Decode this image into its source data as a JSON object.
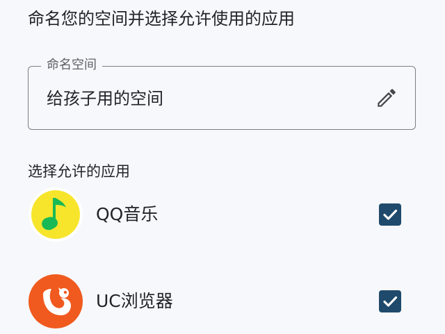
{
  "heading": "命名您的空间并选择允许使用的应用",
  "name_field": {
    "label": "命名空间",
    "value": "给孩子用的空间"
  },
  "apps_section": {
    "label": "选择允许的应用"
  },
  "apps": [
    {
      "name": "QQ音乐",
      "checked": true,
      "icon": "qq-music-icon"
    },
    {
      "name": "UC浏览器",
      "checked": true,
      "icon": "uc-browser-icon"
    }
  ],
  "colors": {
    "background": "#f6f8fb",
    "checkbox": "#1f4a6b",
    "qq_music_yellow": "#f7e52c",
    "qq_music_green": "#19b955",
    "uc_orange": "#f05a1e"
  }
}
